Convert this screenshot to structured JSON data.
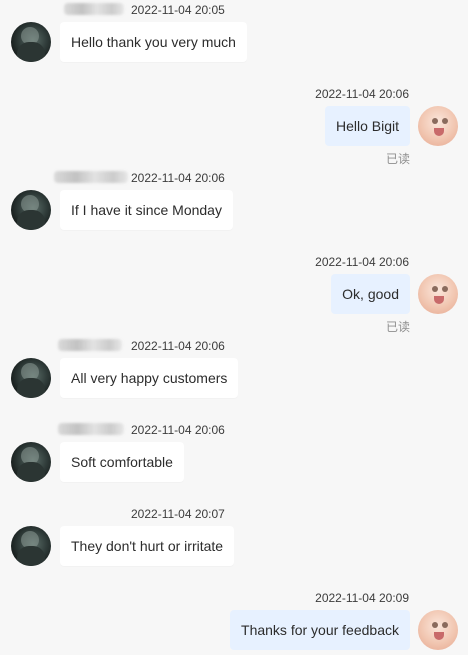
{
  "messages": [
    {
      "side": "left",
      "timestamp": "2022-11-04 20:05",
      "text": "Hello thank you very much",
      "has_blurred_name": true
    },
    {
      "side": "right",
      "timestamp": "2022-11-04 20:06",
      "text": "Hello Bigit",
      "read_label": "已读"
    },
    {
      "side": "left",
      "timestamp": "2022-11-04 20:06",
      "text": "If I have it since Monday",
      "has_blurred_name": true
    },
    {
      "side": "right",
      "timestamp": "2022-11-04 20:06",
      "text": "Ok, good",
      "read_label": "已读"
    },
    {
      "side": "left",
      "timestamp": "2022-11-04 20:06",
      "text": "All very happy customers",
      "has_blurred_name": true
    },
    {
      "side": "left",
      "timestamp": "2022-11-04 20:06",
      "text": "Soft comfortable",
      "has_blurred_name": true
    },
    {
      "side": "left",
      "timestamp": "2022-11-04 20:07",
      "text": "They don't hurt or irritate",
      "has_blurred_name": false
    },
    {
      "side": "right",
      "timestamp": "2022-11-04 20:09",
      "text": "Thanks for your feedback"
    }
  ],
  "icons": {
    "left_avatar": "customer-avatar-icon",
    "right_avatar": "agent-avatar-icon"
  },
  "colors": {
    "background": "#f7f7f7",
    "left_bubble": "#ffffff",
    "right_bubble": "#e7f1ff"
  }
}
